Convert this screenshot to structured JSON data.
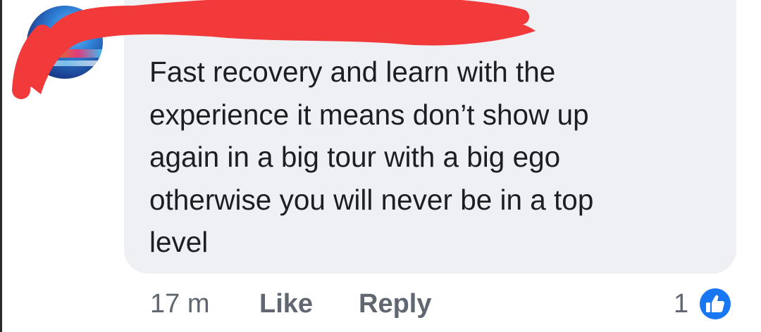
{
  "comment": {
    "text": "Fast recovery and learn with the experience it means don’t show up again in a big tour with a big ego otherwise you will never be in a top level",
    "lines": [
      "Fast recovery and learn with the",
      "experience it means don’t show up",
      "again in a big tour with a big ego",
      "otherwise you will never be in a top",
      "level"
    ]
  },
  "actions": {
    "timestamp": "17 m",
    "like_label": "Like",
    "reply_label": "Reply"
  },
  "reactions": {
    "count": "1",
    "icon": "thumbs-up-icon"
  },
  "colors": {
    "bubble": "#eff0f4",
    "text": "#1c1e21",
    "secondary_text": "#606770",
    "like_blue": "#1877f2",
    "redaction": "#f23a3a"
  }
}
